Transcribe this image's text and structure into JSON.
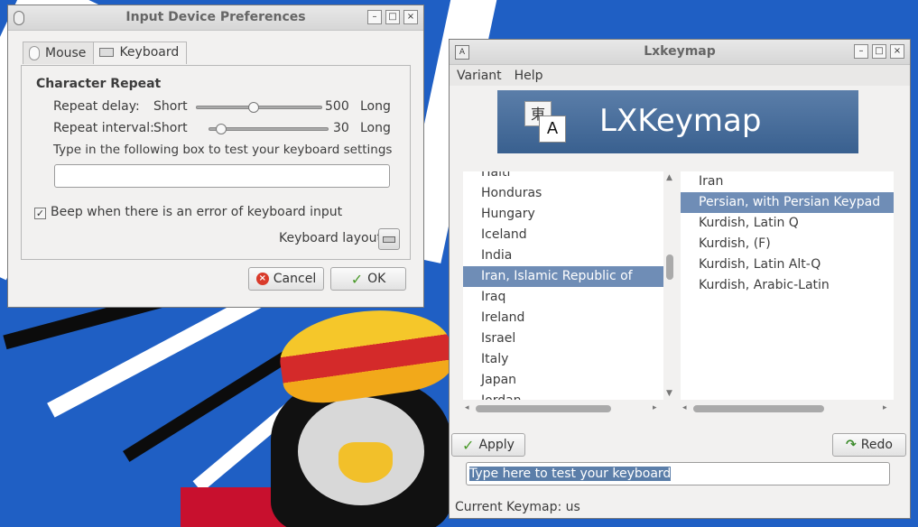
{
  "idp": {
    "title": "Input Device Preferences",
    "tabs": [
      {
        "label": "Mouse",
        "active": false
      },
      {
        "label": "Keyboard",
        "active": true
      }
    ],
    "section_title": "Character Repeat",
    "repeat_delay": {
      "label": "Repeat delay:",
      "min_label": "Short",
      "value": "500",
      "max_label": "Long",
      "fraction": 0.45
    },
    "repeat_interval": {
      "label": "Repeat interval:",
      "min_label": "Short",
      "value": "30",
      "max_label": "Long",
      "fraction": 0.06
    },
    "test_prompt": "Type in the following box to test your keyboard settings",
    "test_value": "",
    "beep_label": "Beep when there is an error of keyboard input",
    "beep_checked": true,
    "layout_label": "Keyboard layout",
    "cancel_label": "Cancel",
    "ok_label": "OK"
  },
  "lxk": {
    "title": "Lxkeymap",
    "menu": [
      "Variant",
      "Help"
    ],
    "banner_text": "LXKeymap",
    "banner_glyph_back": "東",
    "banner_glyph_front": "A",
    "countries": [
      "Haiti",
      "Honduras",
      "Hungary",
      "Iceland",
      "India",
      "Iran, Islamic Republic of",
      "Iraq",
      "Ireland",
      "Israel",
      "Italy",
      "Japan",
      "Jordan"
    ],
    "selected_country": "Iran, Islamic Republic of",
    "variants": [
      "Iran",
      "Persian, with Persian Keypad",
      "Kurdish, Latin Q",
      "Kurdish, (F)",
      "Kurdish, Latin Alt-Q",
      "Kurdish, Arabic-Latin"
    ],
    "selected_variant": "Persian, with Persian Keypad",
    "apply_label": "Apply",
    "redo_label": "Redo",
    "test_value": "Type here to test your keyboard",
    "status": "Current Keymap: us"
  },
  "colors": {
    "selection": "#6f8db6",
    "banner": "#4a6f9c",
    "desktop": "#1f5fc4"
  }
}
